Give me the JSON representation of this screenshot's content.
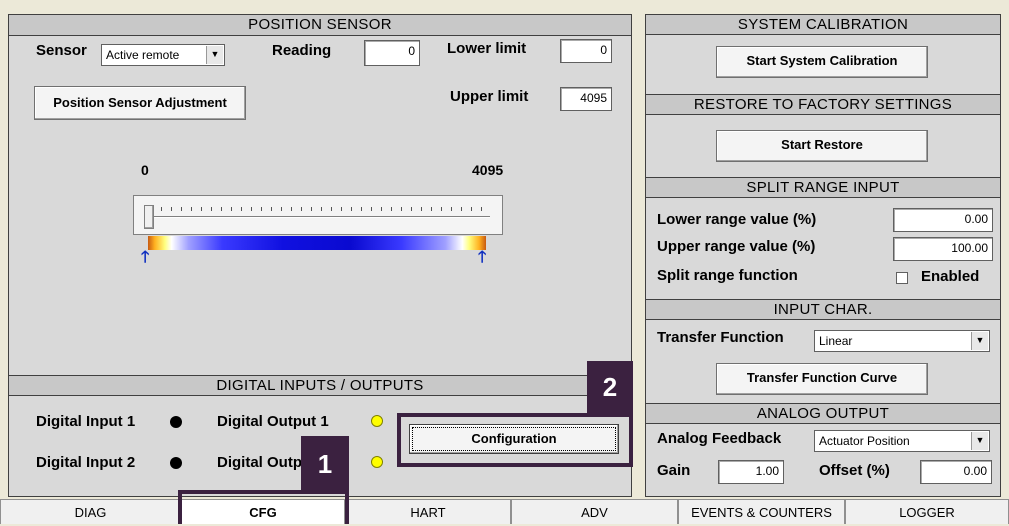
{
  "position_sensor": {
    "title": "POSITION SENSOR",
    "sensor_label": "Sensor",
    "sensor_value": "Active remote",
    "reading_label": "Reading",
    "reading_value": "0",
    "lower_limit_label": "Lower limit",
    "lower_limit_value": "0",
    "upper_limit_label": "Upper limit",
    "upper_limit_value": "4095",
    "adjust_button": "Position Sensor Adjustment",
    "scale_min": "0",
    "scale_max": "4095"
  },
  "digital_io": {
    "title": "DIGITAL INPUTS / OUTPUTS",
    "input1_label": "Digital Input 1",
    "input2_label": "Digital Input 2",
    "output1_label": "Digital Output 1",
    "output2_label": "Digital Output 2",
    "config_button": "Configuration",
    "input_color": "#000000",
    "output_color": "#ffff00"
  },
  "system_calibration": {
    "title": "SYSTEM CALIBRATION",
    "button": "Start System Calibration"
  },
  "restore": {
    "title": "RESTORE TO FACTORY SETTINGS",
    "button": "Start Restore"
  },
  "split_range": {
    "title": "SPLIT RANGE INPUT",
    "lower_label": "Lower range value (%)",
    "lower_value": "0.00",
    "upper_label": "Upper range value (%)",
    "upper_value": "100.00",
    "function_label": "Split range function",
    "enabled_label": "Enabled"
  },
  "input_char": {
    "title": "INPUT CHAR.",
    "transfer_label": "Transfer Function",
    "transfer_value": "Linear",
    "curve_button": "Transfer Function Curve"
  },
  "analog_output": {
    "title": "ANALOG OUTPUT",
    "feedback_label": "Analog Feedback",
    "feedback_value": "Actuator Position",
    "gain_label": "Gain",
    "gain_value": "1.00",
    "offset_label": "Offset (%)",
    "offset_value": "0.00"
  },
  "tabs": [
    "DIAG",
    "CFG",
    "HART",
    "ADV",
    "EVENTS & COUNTERS",
    "LOGGER"
  ],
  "active_tab": "CFG",
  "callouts": [
    "1",
    "2"
  ],
  "accent_color": "#3b2140"
}
